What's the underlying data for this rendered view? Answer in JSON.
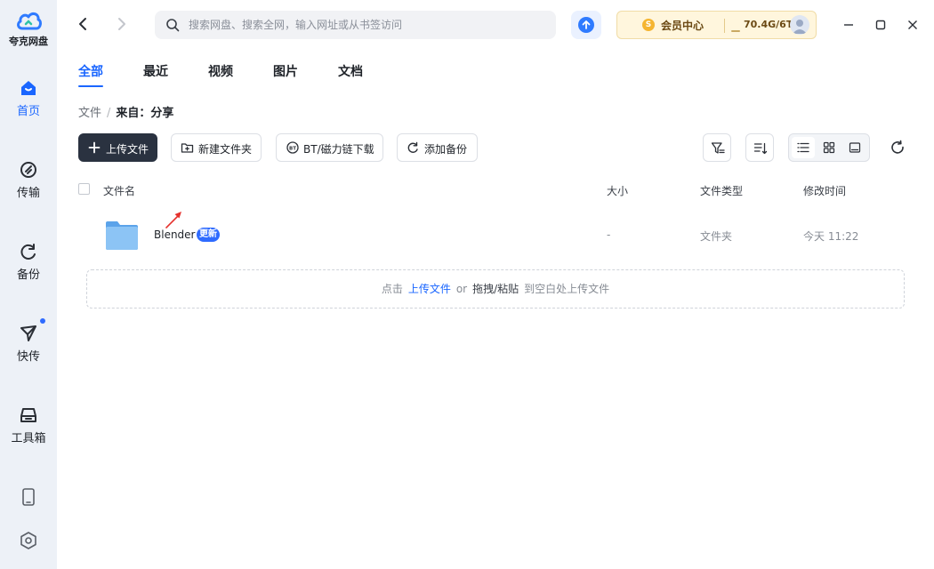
{
  "app": {
    "name": "夸克网盘"
  },
  "sidebar": {
    "items": [
      {
        "label": "首页",
        "icon": "home-icon",
        "active": true
      },
      {
        "label": "传输",
        "icon": "transfer-icon"
      },
      {
        "label": "备份",
        "icon": "backup-icon"
      },
      {
        "label": "快传",
        "icon": "quick-send-icon",
        "has_dot": true
      },
      {
        "label": "工具箱",
        "icon": "toolbox-icon"
      }
    ],
    "bottom_icons": [
      "phone-icon",
      "settings-icon"
    ]
  },
  "topbar": {
    "search_placeholder": "搜索网盘、搜索全网，输入网址或从书签访问",
    "vip_badge": "S",
    "vip_label": "会员中心",
    "storage": "70.4G/6T"
  },
  "tabs": [
    {
      "label": "全部",
      "active": true
    },
    {
      "label": "最近"
    },
    {
      "label": "视频"
    },
    {
      "label": "图片"
    },
    {
      "label": "文档"
    }
  ],
  "breadcrumb": {
    "root": "文件",
    "sep": "/",
    "current": "来自：分享"
  },
  "toolbar": {
    "upload": "上传文件",
    "new_folder": "新建文件夹",
    "bt_download": "BT/磁力链下载",
    "add_backup": "添加备份"
  },
  "table": {
    "headers": {
      "name": "文件名",
      "size": "大小",
      "type": "文件类型",
      "modified": "修改时间"
    },
    "rows": [
      {
        "name": "Blender",
        "badge": "更新",
        "size": "-",
        "type": "文件夹",
        "modified": "今天 11:22"
      }
    ]
  },
  "dropzone": {
    "prefix": "点击",
    "link": "上传文件",
    "or": "or",
    "strong": "拖拽/粘贴",
    "suffix": "到空白处上传文件"
  },
  "colors": {
    "accent": "#1a66ff",
    "primary_button": "#2a3240",
    "folder": "#6fb3f2",
    "vip_bg": "#fff6dd"
  }
}
